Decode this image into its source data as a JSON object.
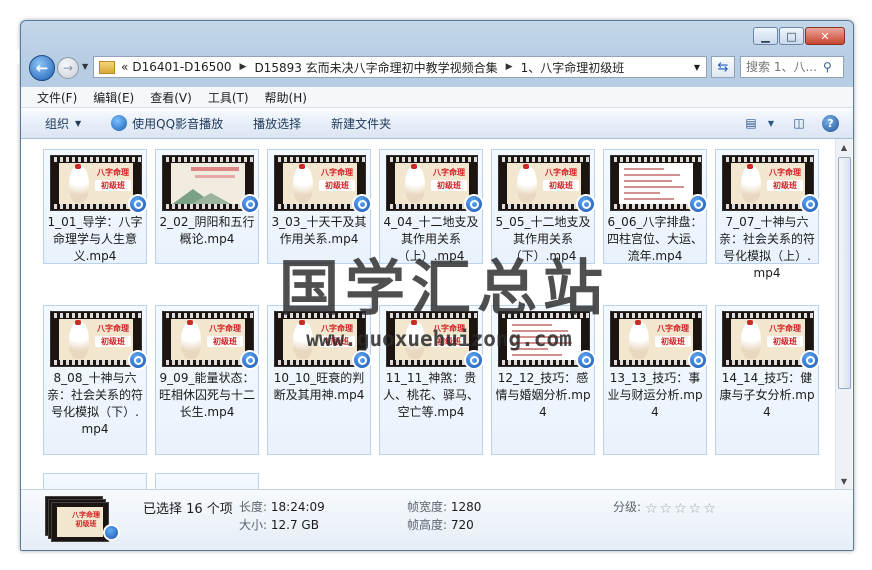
{
  "window": {
    "minimize_glyph": "▁",
    "maximize_glyph": "□",
    "close_glyph": "✕"
  },
  "nav": {
    "back_glyph": "←",
    "forward_glyph": "→",
    "address": {
      "overflow": "«",
      "segments": [
        "D16401-D16500",
        "D15893 玄而未决八字命理初中教学视频合集",
        "1、八字命理初级班"
      ]
    },
    "search_placeholder": "搜索 1、八..."
  },
  "menu": [
    "文件(F)",
    "编辑(E)",
    "查看(V)",
    "工具(T)",
    "帮助(H)"
  ],
  "toolbar": {
    "organize": "组织",
    "qq_play": "使用QQ影音播放",
    "playlist": "播放选择",
    "new_folder": "新建文件夹",
    "help_glyph": "?"
  },
  "files": [
    {
      "label": "1_01_导学：八字命理学与人生意义.mp4",
      "thumb": "crane"
    },
    {
      "label": "2_02_阴阳和五行概论.mp4",
      "thumb": "landscape"
    },
    {
      "label": "3_03_十天干及其作用关系.mp4",
      "thumb": "crane"
    },
    {
      "label": "4_04_十二地支及其作用关系（上）.mp4",
      "thumb": "crane"
    },
    {
      "label": "5_05_十二地支及其作用关系（下）.mp4",
      "thumb": "crane"
    },
    {
      "label": "6_06_八字排盘：四柱宫位、大运、流年.mp4",
      "thumb": "doc"
    },
    {
      "label": "7_07_十神与六亲：社会关系的符号化模拟（上）.mp4",
      "thumb": "crane"
    },
    {
      "label": "8_08_十神与六亲：社会关系的符号化模拟（下）.mp4",
      "thumb": "crane"
    },
    {
      "label": "9_09_能量状态：旺相休囚死与十二长生.mp4",
      "thumb": "crane"
    },
    {
      "label": "10_10_旺衰的判断及其用神.mp4",
      "thumb": "crane"
    },
    {
      "label": "11_11_神煞：贵人、桃花、驿马、空亡等.mp4",
      "thumb": "crane"
    },
    {
      "label": "12_12_技巧：感情与婚姻分析.mp4",
      "thumb": "doc"
    },
    {
      "label": "13_13_技巧：事业与财运分析.mp4",
      "thumb": "crane"
    },
    {
      "label": "14_14_技巧：健康与子女分析.mp4",
      "thumb": "crane"
    }
  ],
  "thumb_text": {
    "line1": "八字命理",
    "line2": "初级班"
  },
  "watermark": {
    "title": "国学汇总站",
    "url": "www.guoxuehuizong.com"
  },
  "details": {
    "selected": "已选择 16 个项",
    "length_label": "长度:",
    "length": "18:24:09",
    "size_label": "大小:",
    "size": "12.7 GB",
    "width_label": "帧宽度:",
    "width": "1280",
    "height_label": "帧高度:",
    "height": "720",
    "rating_label": "分级:",
    "rating": "☆☆☆☆☆"
  },
  "colors": {
    "accent": "#1d5fb6",
    "thumb_title": "#d22222"
  }
}
